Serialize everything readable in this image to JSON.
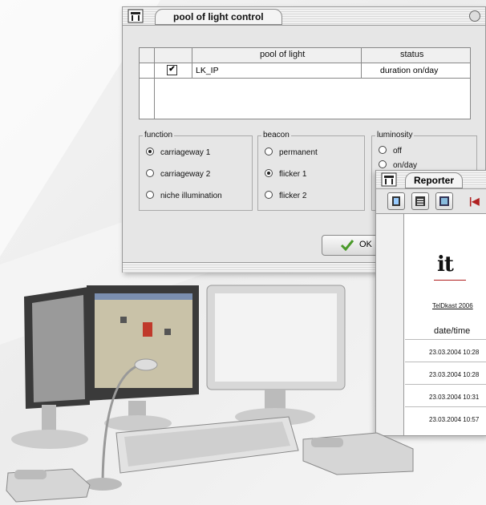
{
  "pool_window": {
    "title": "pool of light control",
    "table": {
      "headers": [
        "pool of light",
        "status"
      ],
      "rows": [
        {
          "checked": true,
          "name": "LK_IP",
          "status": "duration on/day"
        }
      ]
    },
    "groups": {
      "function": {
        "label": "function",
        "options": [
          "carriageway 1",
          "carriageway 2",
          "niche illumination"
        ],
        "selected": "carriageway 1"
      },
      "beacon": {
        "label": "beacon",
        "options": [
          "permanent",
          "flicker 1",
          "flicker 2"
        ],
        "selected": "flicker 1"
      },
      "luminosity": {
        "label": "luminosity",
        "options": [
          "off",
          "on/day"
        ],
        "selected": ""
      }
    },
    "ok_label": "OK",
    "check_mark": "✔"
  },
  "reporter_window": {
    "title": "Reporter",
    "logo": "it",
    "doc_title": "TelDkast 2006",
    "date_header": "date/time",
    "dates": [
      "23.03.2004 10:28",
      "23.03.2004 10:28",
      "23.03.2004 10:31",
      "23.03.2004 10:57"
    ]
  }
}
